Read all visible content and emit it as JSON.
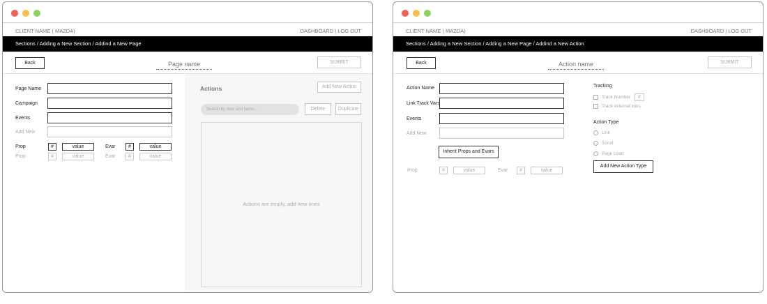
{
  "window1": {
    "client_name": "CLIENT NAME ( MAZDA)",
    "top_links": "DASHBOARD | LOG OUT",
    "breadcrumb": "Sections / Adding a New Section / Addind a New Page",
    "back_label": "Back",
    "name_placeholder": "Page name",
    "submit_label": "SUBMIT",
    "form": {
      "page_name_label": "Page Name",
      "campaign_label": "Campaign",
      "events_label": "Events",
      "add_new_label": "Add New",
      "prop_label": "Prop",
      "evar_label": "Evar",
      "hash": "#",
      "value": "value"
    },
    "actions": {
      "title": "Actions",
      "add_new_action": "Add New Action",
      "search_placeholder": "Search by date and name...",
      "delete_label": "Delete",
      "duplicate_label": "Duplicate",
      "empty_text": "Actions are empty, add new ones"
    }
  },
  "window2": {
    "client_name": "CLIENT NAME ( MAZDA)",
    "top_links": "DASHBOARD | LOG OUT",
    "breadcrumb": "Sections / Adding a New Section / Adding a New Page / Addind a New Action",
    "back_label": "Back",
    "name_placeholder": "Action name",
    "submit_label": "SUBMIT",
    "form": {
      "action_name_label": "Action Name",
      "link_track_vars_label": "Link Track Vars",
      "events_label": "Events",
      "add_new_label": "Add New",
      "inherit_label": "Inherit Props and Evars",
      "prop_label": "Prop",
      "evar_label": "Evar",
      "hash": "#",
      "value": "value"
    },
    "tracking": {
      "title": "Tracking",
      "track_number": "Track Number",
      "track_number_hash": "#",
      "track_external": "Track external links"
    },
    "action_type": {
      "title": "Action Type",
      "options": [
        "Link",
        "Scroll",
        "Page Load"
      ],
      "add_new_type": "Add New Action Type"
    }
  }
}
